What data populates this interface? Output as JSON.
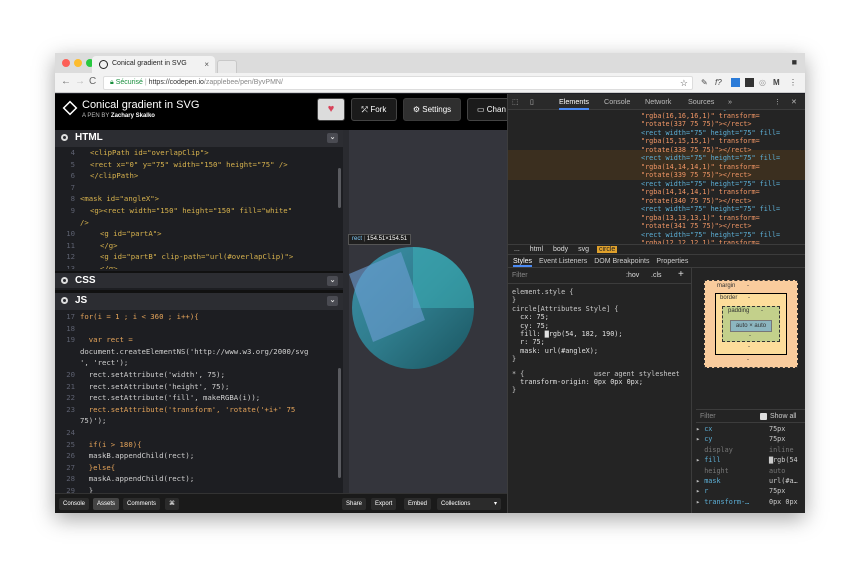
{
  "browser": {
    "tab_title": "Conical gradient in SVG",
    "secure_label": "Sécurisé",
    "url_host": "https://codepen.io",
    "url_path": "/zapplebee/pen/ByvPMN/"
  },
  "header": {
    "title": "Conical gradient in SVG",
    "by_prefix": "A PEN BY",
    "author": "Zachary Skalko",
    "fork": "Fork",
    "settings": "Settings",
    "change": "Chan"
  },
  "panels": {
    "html": "HTML",
    "css": "CSS",
    "js": "JS"
  },
  "html_code": [
    {
      "n": "4",
      "text": "<clipPath id=\"overlapClip\">"
    },
    {
      "n": "5",
      "text": "<rect x=\"0\" y=\"75\" width=\"150\" height=\"75\" />"
    },
    {
      "n": "6",
      "text": "</clipPath>"
    },
    {
      "n": "7",
      "text": ""
    },
    {
      "n": "8",
      "text": "<mask id=\"angleX\">"
    },
    {
      "n": "9",
      "text": "<g><rect width=\"150\" height=\"150\" fill=\"white\""
    },
    {
      "n": "",
      "text": "/>"
    },
    {
      "n": "10",
      "text": "<g id=\"partA\">"
    },
    {
      "n": "11",
      "text": "</g>"
    },
    {
      "n": "12",
      "text": "<g id=\"partB\" clip-path=\"url(#overlapClip)\">"
    },
    {
      "n": "13",
      "text": "</g>"
    }
  ],
  "js_code": [
    {
      "n": "17",
      "text": "for(i = 1 ; i < 360 ; i++){"
    },
    {
      "n": "18",
      "text": ""
    },
    {
      "n": "19",
      "text": "  var rect ="
    },
    {
      "n": "",
      "text": "document.createElementNS('http://www.w3.org/2000/svg"
    },
    {
      "n": "",
      "text": "', 'rect');"
    },
    {
      "n": "20",
      "text": "  rect.setAttribute('width', 75);"
    },
    {
      "n": "21",
      "text": "  rect.setAttribute('height', 75);"
    },
    {
      "n": "22",
      "text": "  rect.setAttribute('fill', makeRGBA(i));"
    },
    {
      "n": "23",
      "text": "  rect.setAttribute('transform', 'rotate('+i+' 75"
    },
    {
      "n": "",
      "text": "75)');"
    },
    {
      "n": "24",
      "text": ""
    },
    {
      "n": "25",
      "text": "  if(i > 180){"
    },
    {
      "n": "26",
      "text": "  maskB.appendChild(rect);"
    },
    {
      "n": "27",
      "text": "  }else{"
    },
    {
      "n": "28",
      "text": "  maskA.appendChild(rect);"
    },
    {
      "n": "29",
      "text": "  }"
    }
  ],
  "preview": {
    "tooltip_tag": "rect",
    "tooltip_size": "154.51×154.51"
  },
  "footer": {
    "console": "Console",
    "assets": "Assets",
    "comments": "Comments",
    "shortcut": "⌘",
    "share": "Share",
    "export": "Export",
    "embed": "Embed",
    "collections": "Collections"
  },
  "devtools": {
    "tabs": [
      "Elements",
      "Console",
      "Network",
      "Sources",
      "»"
    ],
    "elements_lines": [
      "<rect width=\"75\" height=\"75\" fill=",
      "\"rgba(16,16,16,1)\" transform=",
      "\"rotate(337 75 75)\"></rect>",
      "<rect width=\"75\" height=\"75\" fill=",
      "\"rgba(15,15,15,1)\" transform=",
      "\"rotate(338 75 75)\"></rect>",
      "<rect width=\"75\" height=\"75\" fill=",
      "\"rgba(14,14,14,1)\" transform=",
      "\"rotate(339 75 75)\"></rect>",
      "<rect width=\"75\" height=\"75\" fill=",
      "\"rgba(14,14,14,1)\" transform=",
      "\"rotate(340 75 75)\"></rect>",
      "<rect width=\"75\" height=\"75\" fill=",
      "\"rgba(13,13,13,1)\" transform=",
      "\"rotate(341 75 75)\"></rect>",
      "<rect width=\"75\" height=\"75\" fill=",
      "\"rgba(12,12,12,1)\" transform="
    ],
    "breadcrumbs": [
      "...",
      "html",
      "body",
      "svg",
      "circle"
    ],
    "subtabs": [
      "Styles",
      "Event Listeners",
      "DOM Breakpoints",
      "Properties"
    ],
    "filter": "Filter",
    "hov": ":hov",
    "cls": ".cls",
    "styles_lines": [
      "element.style {",
      "}",
      "circle[Attributes Style] {",
      "  cx: 75;",
      "  cy: 75;",
      "  fill: ▇rgb(54, 182, 190);",
      "  r: 75;",
      "  mask: url(#angleX);",
      "}",
      "* {                 user agent stylesheet",
      "  transform-origin: 0px 0px 0px;",
      "}"
    ],
    "boxmodel": {
      "margin": "margin",
      "border": "border",
      "padding": "padding",
      "content": "auto × auto",
      "dash": "-"
    },
    "computed_filter": "Filter",
    "show_all": "Show all",
    "computed": [
      {
        "p": "cx",
        "v": "75px"
      },
      {
        "p": "cy",
        "v": "75px"
      },
      {
        "p": "display",
        "v": "inline"
      },
      {
        "p": "fill",
        "v": "▇rgb(54"
      },
      {
        "p": "height",
        "v": "auto"
      },
      {
        "p": "mask",
        "v": "url(#a…"
      },
      {
        "p": "r",
        "v": "75px"
      },
      {
        "p": "transform-…",
        "v": "0px 0px"
      }
    ]
  },
  "colors": {
    "circle_fill": "#36b6be",
    "accent_blue": "#4a8af4",
    "heart": "#d8425a"
  }
}
